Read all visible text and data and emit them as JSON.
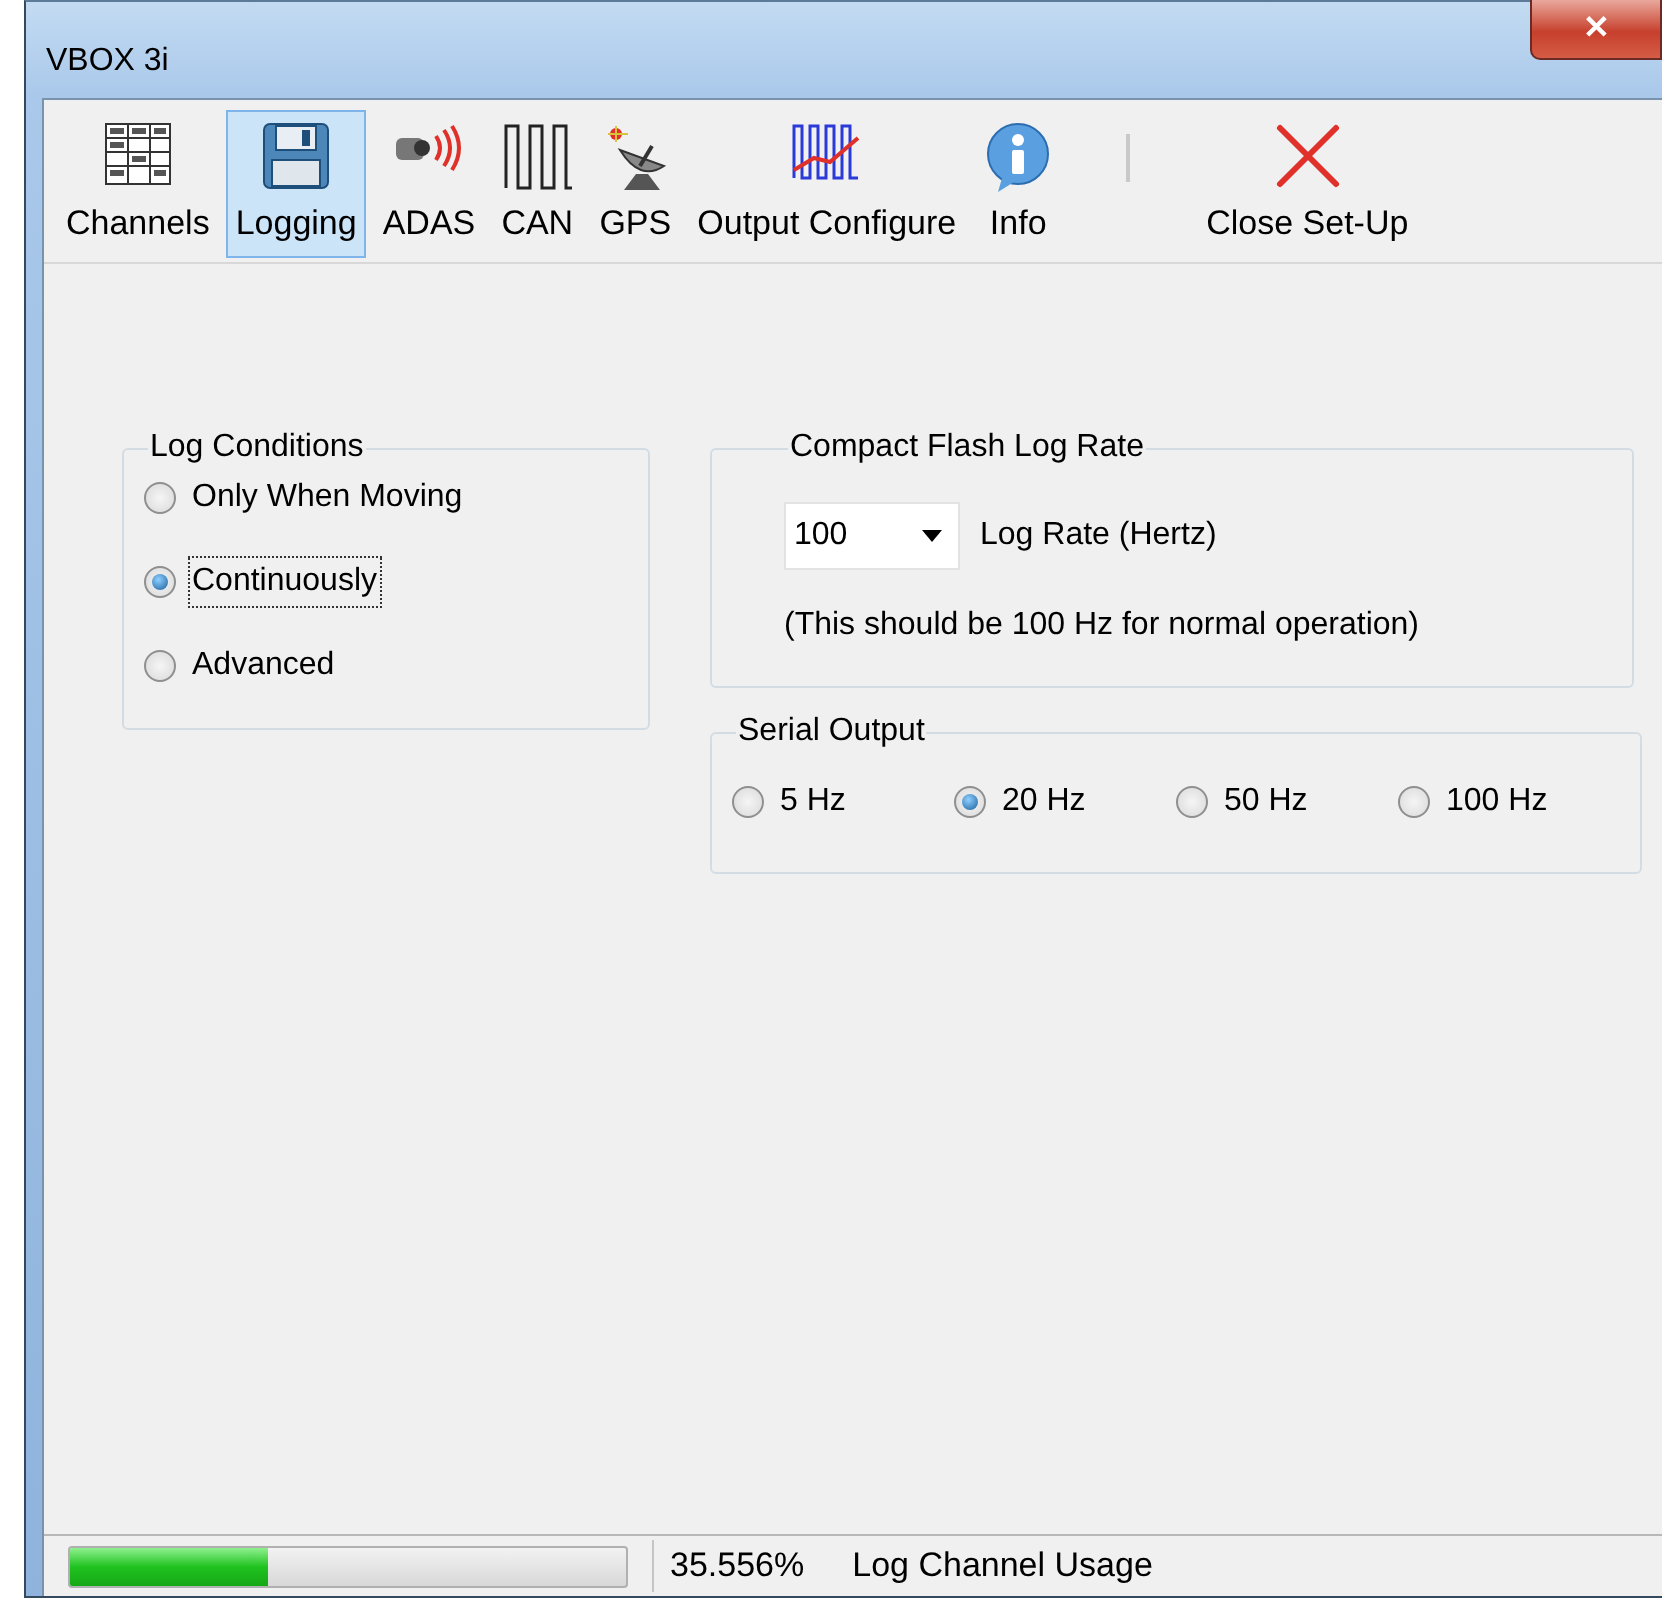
{
  "window": {
    "title": "VBOX 3i",
    "close_button": "✕"
  },
  "toolbar": {
    "items": [
      {
        "label": "Channels",
        "selected": false
      },
      {
        "label": "Logging",
        "selected": true
      },
      {
        "label": "ADAS",
        "selected": false
      },
      {
        "label": "CAN",
        "selected": false
      },
      {
        "label": "GPS",
        "selected": false
      },
      {
        "label": "Output Configure",
        "selected": false
      },
      {
        "label": "Info",
        "selected": false
      }
    ],
    "trailing_items": [
      {
        "label": "Close Set-Up",
        "selected": false
      }
    ]
  },
  "log_conditions": {
    "title": "Log Conditions",
    "options": [
      {
        "label": "Only When Moving",
        "selected": false,
        "focused": false
      },
      {
        "label": "Continuously",
        "selected": true,
        "focused": true
      },
      {
        "label": "Advanced",
        "selected": false,
        "focused": false
      }
    ]
  },
  "compact_flash_log_rate": {
    "title": "Compact Flash Log Rate",
    "rate_value": "100",
    "rate_label": "Log Rate (Hertz)",
    "note": "(This should be 100 Hz for normal operation)"
  },
  "serial_output": {
    "title": "Serial Output",
    "options": [
      {
        "label": "5 Hz",
        "selected": false
      },
      {
        "label": "20 Hz",
        "selected": true
      },
      {
        "label": "50 Hz",
        "selected": false
      },
      {
        "label": "100 Hz",
        "selected": false
      }
    ]
  },
  "status_bar": {
    "level": 0.356,
    "percentage": "35.556%",
    "label": "Log Channel Usage"
  }
}
